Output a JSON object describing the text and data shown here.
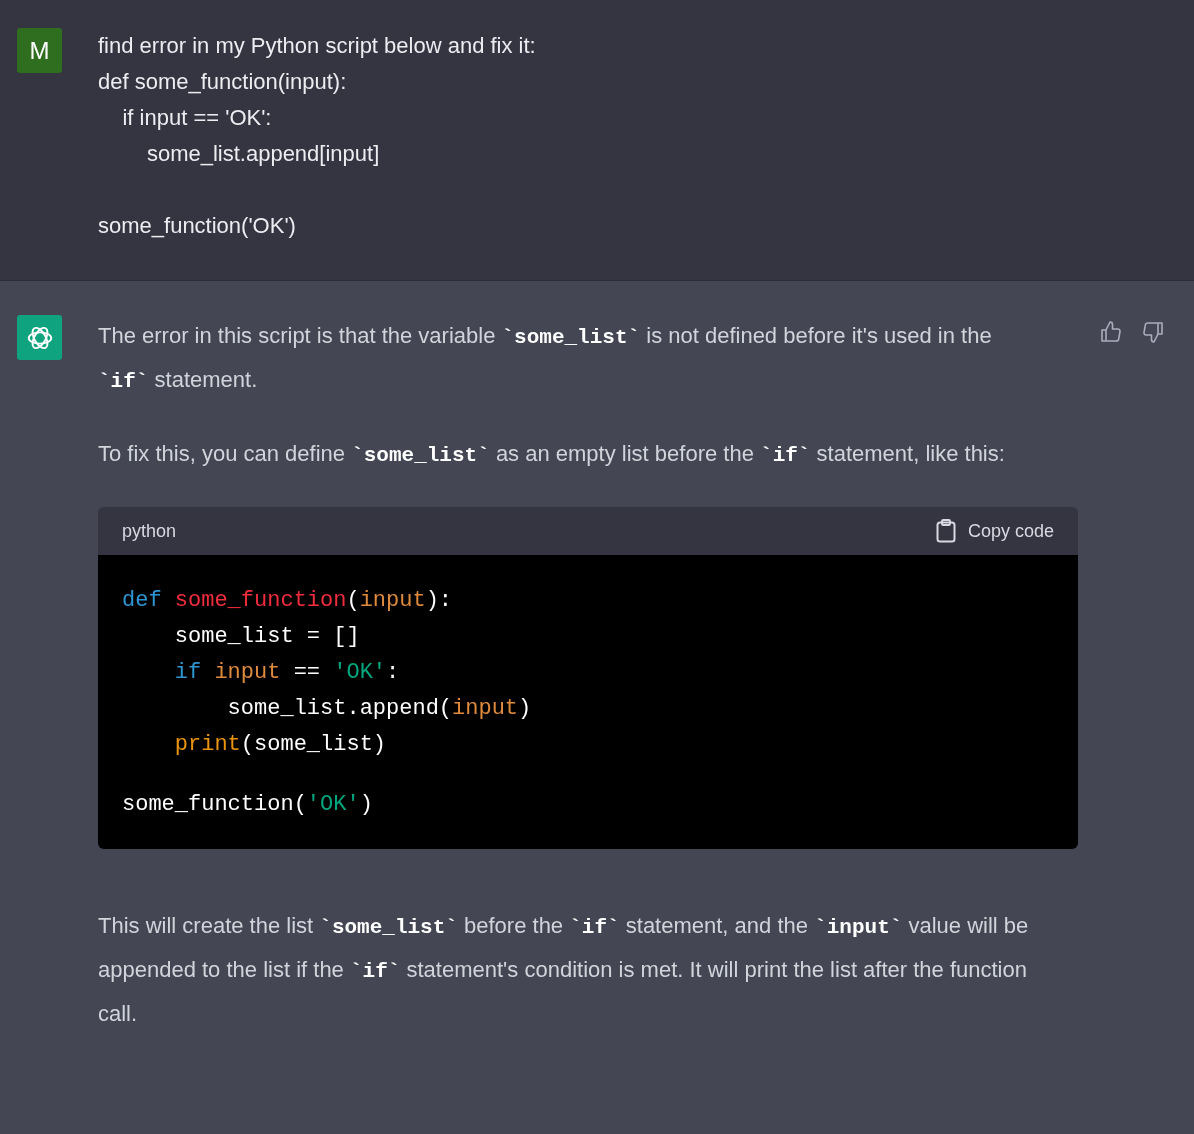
{
  "user_message": {
    "avatar_letter": "M",
    "blocks": [
      [
        "find error in my Python script below and fix it:",
        "def some_function(input):",
        "    if input == 'OK':",
        "        some_list.append[input]"
      ],
      [
        "some_function('OK')"
      ]
    ]
  },
  "assistant_message": {
    "paragraphs_before": [
      [
        {
          "kind": "text",
          "text": "The error in this script is that the variable "
        },
        {
          "kind": "code",
          "text": "`some_list`"
        },
        {
          "kind": "text",
          "text": " is not defined before it's used in the "
        },
        {
          "kind": "code",
          "text": "`if`"
        },
        {
          "kind": "text",
          "text": " statement."
        }
      ],
      [
        {
          "kind": "text",
          "text": "To fix this, you can define "
        },
        {
          "kind": "code",
          "text": "`some_list`"
        },
        {
          "kind": "text",
          "text": " as an empty list before the "
        },
        {
          "kind": "code",
          "text": "`if`"
        },
        {
          "kind": "text",
          "text": " statement, like this:"
        }
      ]
    ],
    "code_block": {
      "language": "python",
      "copy_label": "Copy code",
      "blocks": [
        [
          [
            {
              "kind": "keyword",
              "text": "def"
            },
            {
              "kind": "function",
              "text": " some_function"
            },
            {
              "kind": "plain",
              "text": "("
            },
            {
              "kind": "param",
              "text": "input"
            },
            {
              "kind": "plain",
              "text": "):"
            }
          ],
          [
            {
              "kind": "plain",
              "text": "    some_list = []"
            }
          ],
          [
            {
              "kind": "keyword",
              "text": "    if"
            },
            {
              "kind": "param",
              "text": " input"
            },
            {
              "kind": "plain",
              "text": " == "
            },
            {
              "kind": "string",
              "text": "'OK'"
            },
            {
              "kind": "plain",
              "text": ":"
            }
          ],
          [
            {
              "kind": "plain",
              "text": "        some_list.append("
            },
            {
              "kind": "param",
              "text": "input"
            },
            {
              "kind": "plain",
              "text": ")"
            }
          ],
          [
            {
              "kind": "builtin",
              "text": "    print"
            },
            {
              "kind": "plain",
              "text": "(some_list)"
            }
          ]
        ],
        [
          [
            {
              "kind": "plain",
              "text": "some_function("
            },
            {
              "kind": "string",
              "text": "'OK'"
            },
            {
              "kind": "plain",
              "text": ")"
            }
          ]
        ]
      ]
    },
    "paragraphs_after": [
      [
        {
          "kind": "text",
          "text": "This will create the list "
        },
        {
          "kind": "code",
          "text": "`some_list`"
        },
        {
          "kind": "text",
          "text": " before the "
        },
        {
          "kind": "code",
          "text": "`if`"
        },
        {
          "kind": "text",
          "text": " statement, and the "
        },
        {
          "kind": "code",
          "text": "`input`"
        },
        {
          "kind": "text",
          "text": " value will be appended to the list if the "
        },
        {
          "kind": "code",
          "text": "`if`"
        },
        {
          "kind": "text",
          "text": " statement's condition is met. It will print the list after the function call."
        }
      ]
    ]
  }
}
